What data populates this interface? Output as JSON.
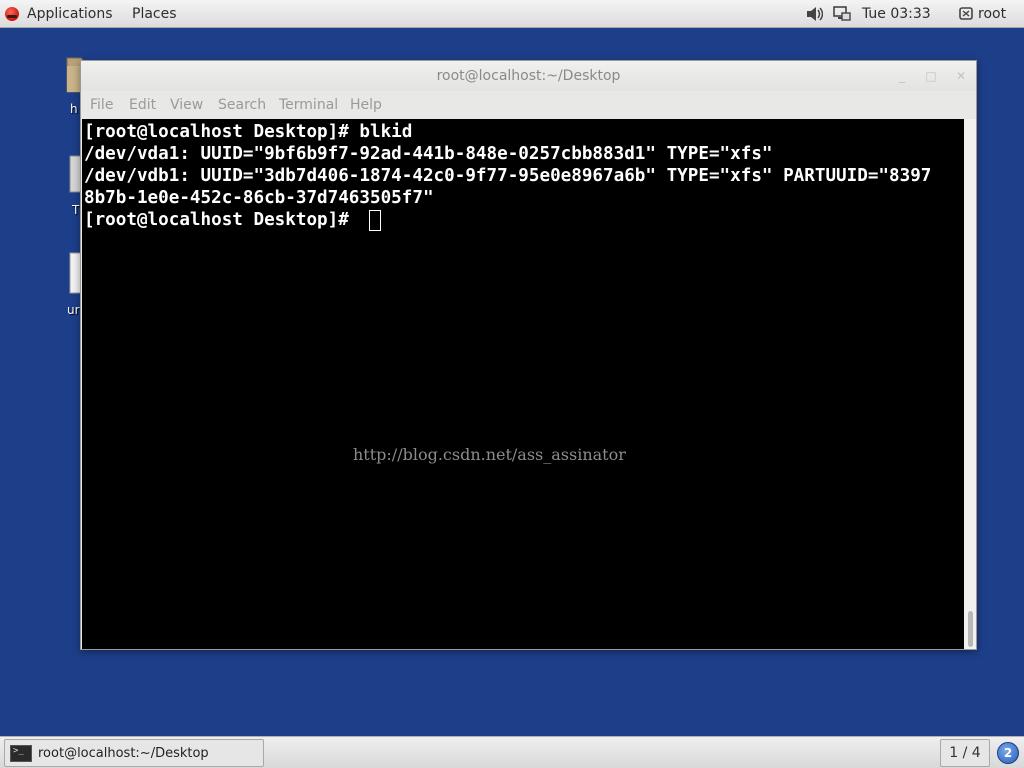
{
  "top_panel": {
    "applications_label": "Applications",
    "places_label": "Places",
    "clock": "Tue 03:33",
    "user": "root",
    "icons": [
      "redhat-logo-icon",
      "volume-icon",
      "network-icon",
      "user-icon"
    ]
  },
  "desktop": {
    "icons": [
      {
        "name": "home-folder",
        "label": "h"
      },
      {
        "name": "trash",
        "label": "T"
      },
      {
        "name": "unknown-file",
        "label": "ur"
      }
    ],
    "background_color": "#1d3f8a"
  },
  "window": {
    "title": "root@localhost:~/Desktop",
    "menu": [
      "File",
      "Edit",
      "View",
      "Search",
      "Terminal",
      "Help"
    ]
  },
  "terminal": {
    "lines": [
      "[root@localhost Desktop]# blkid",
      "/dev/vda1: UUID=\"9bf6b9f7-92ad-441b-848e-0257cbb883d1\" TYPE=\"xfs\"",
      "/dev/vdb1: UUID=\"3db7d406-1874-42c0-9f77-95e0e8967a6b\" TYPE=\"xfs\" PARTUUID=\"8397",
      "8b7b-1e0e-452c-86cb-37d7463505f7\"",
      "[root@localhost Desktop]# "
    ],
    "watermark": "http://blog.csdn.net/ass_assinator",
    "background": "#000000",
    "foreground": "#ffffff"
  },
  "taskbar": {
    "task_label": "root@localhost:~/Desktop",
    "workspace": "1 / 4",
    "notifications": "2"
  }
}
